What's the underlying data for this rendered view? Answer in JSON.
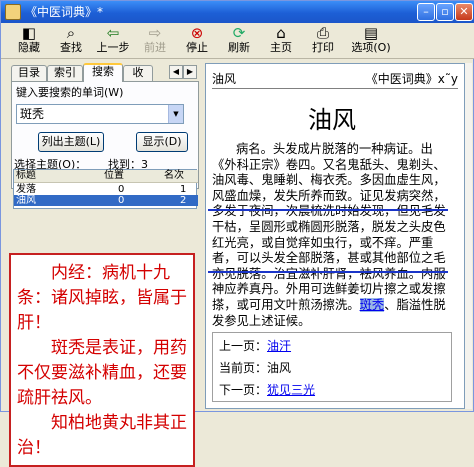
{
  "window": {
    "title": "《中医词典》*"
  },
  "toolbar": {
    "buttons": [
      {
        "label": "隐藏",
        "icon": "hide-icon"
      },
      {
        "label": "查找",
        "icon": "find-icon"
      },
      {
        "label": "上一步",
        "icon": "back-icon"
      },
      {
        "label": "前进",
        "icon": "forward-icon"
      },
      {
        "label": "停止",
        "icon": "stop-icon"
      },
      {
        "label": "刷新",
        "icon": "refresh-icon"
      },
      {
        "label": "主页",
        "icon": "home-icon"
      },
      {
        "label": "打印",
        "icon": "print-icon"
      },
      {
        "label": "选项(O)",
        "icon": "options-icon"
      }
    ]
  },
  "tabs": [
    "目录",
    "索引",
    "搜索",
    "收"
  ],
  "search": {
    "prompt": "键入要搜索的单词(W)",
    "value": "斑秃",
    "list_topics_label": "列出主题(L)",
    "display_label": "显示(D)",
    "select_label": "选择主题(O)：",
    "found_label": "找到：3"
  },
  "results": {
    "columns": [
      "标题",
      "位置",
      "名次"
    ],
    "rows": [
      {
        "title": "发落",
        "location": "0",
        "rank": "1"
      },
      {
        "title": "油风",
        "location": "0",
        "rank": "2"
      }
    ]
  },
  "note": {
    "p1": "内经：病机十九条：诸风掉眩，皆属于肝！",
    "p2": "斑秃是表证，用药不仅要滋补精血，还要疏肝祛风。",
    "p3": "知柏地黄丸非其正治！"
  },
  "document": {
    "header_left": "油风",
    "header_right": "《中医词典》x˜y",
    "title": "油风",
    "body": {
      "part1": "病名。头发成片脱落的一种病证。出《外科正宗》卷四。又名鬼舐头、鬼剃头、油风毒、鬼睡剃、梅衣秃。多因血虚生风，风盛血燥，发失所养而致。证见发病突然，多发于夜间，次晨梳洗时始发现，但见毛发干枯，呈圆形或椭圆形脱落，脱发之头皮色红光亮，或自觉痒如虫行，或不痒。严重者，可以头发全部脱落，甚或其他部位之毛亦见脱落。治宜滋补肝肾，祛风养血。内服神应养真丹。外用可选鲜姜切片擦之或发擦搽，或可用文叶煎汤擦洗。",
      "link_word": "斑秃",
      "part2": "、脂溢性脱发参见上述证候。"
    },
    "nav": {
      "up_label": "上一页：",
      "up_link": "油汗",
      "current_label": "当前页：",
      "current_value": "油风",
      "down_label": "下一页：",
      "down_link": "犹见三光"
    }
  },
  "colors": {
    "note_text": "#d40000",
    "note_border": "#c62020",
    "underline_blue": "#1a35c9",
    "link": "#0000ee",
    "selection": "#316ac5"
  }
}
